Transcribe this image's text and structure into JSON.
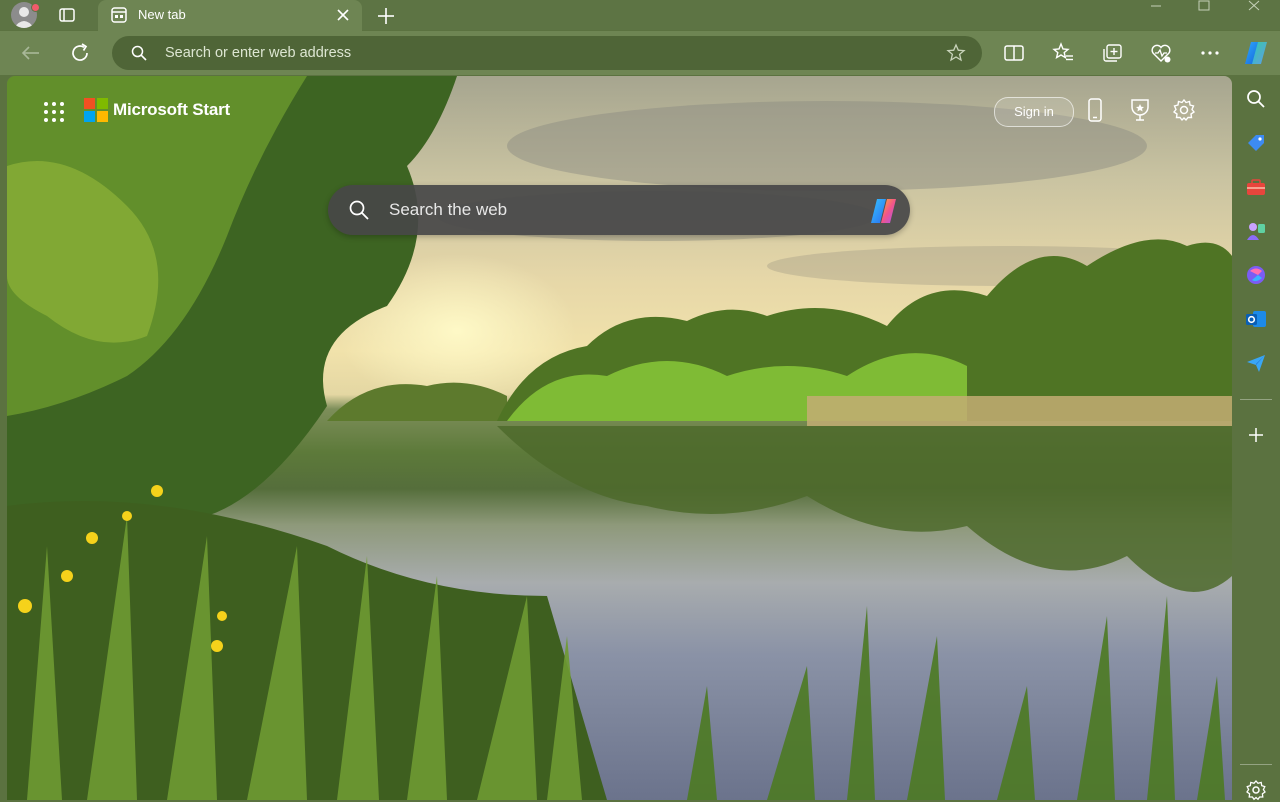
{
  "browser": {
    "tab": {
      "title": "New tab"
    },
    "address_bar": {
      "placeholder": "Search or enter web address"
    },
    "window_controls": [
      "minimize",
      "maximize",
      "close"
    ],
    "toolbar_icons": [
      "back-icon",
      "refresh-icon",
      "split-screen-icon",
      "favorites-icon",
      "collections-icon",
      "browser-essentials-icon",
      "more-icon",
      "copilot-icon"
    ]
  },
  "page": {
    "brand": "Microsoft Start",
    "sign_in": "Sign in",
    "search_placeholder": "Search the web",
    "header_icons": [
      "phone-icon",
      "rewards-icon",
      "settings-icon"
    ]
  },
  "sidebar": {
    "items": [
      "search-icon",
      "shopping-icon",
      "tools-icon",
      "games-icon",
      "microsoft-365-icon",
      "outlook-icon",
      "drop-icon",
      "add-icon",
      "settings-icon"
    ]
  },
  "colors": {
    "frame": "#5b7240",
    "toolbar": "#6e8553",
    "address_bar": "#4f6537",
    "search_box": "#464648"
  }
}
